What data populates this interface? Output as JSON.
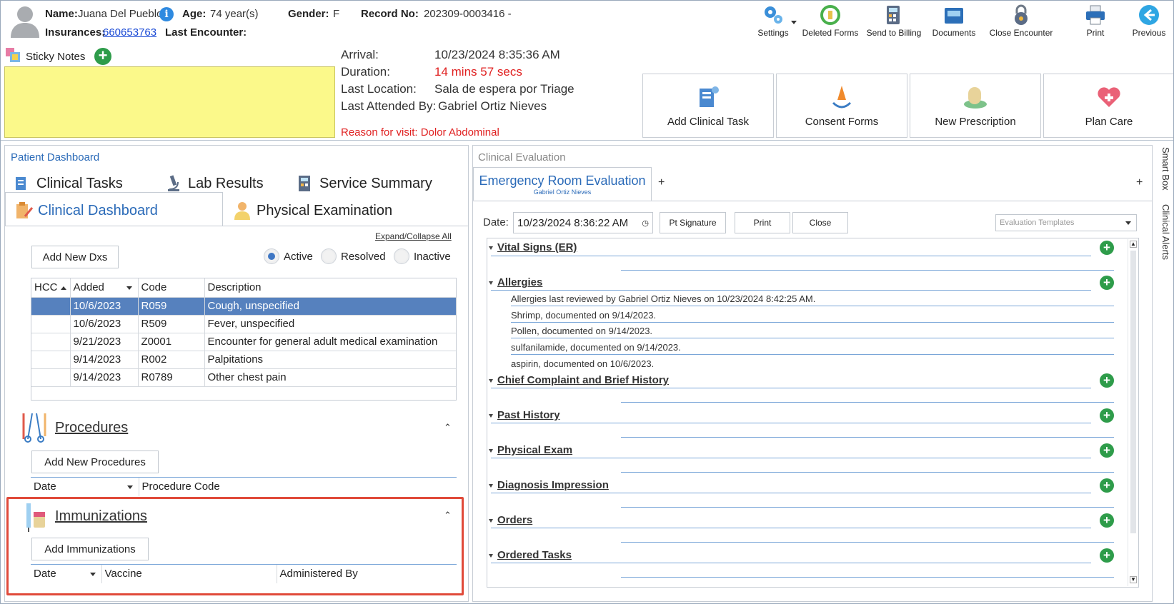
{
  "header": {
    "name_label": "Name:",
    "name_value": "Juana Del Pueblo",
    "info_icon": "info-icon",
    "age_label": "Age:",
    "age_value": "74 year(s)",
    "gender_label": "Gender:",
    "gender_value": "F",
    "record_label": "Record No:",
    "record_value": "202309-0003416 -",
    "insurances_label": "Insurances:",
    "insurances_value": "660653763",
    "last_encounter_label": "Last Encounter:"
  },
  "toolbar": {
    "settings": "Settings",
    "deleted_forms": "Deleted Forms",
    "send_to_billing": "Send to Billing",
    "documents": "Documents",
    "close_encounter": "Close Encounter",
    "print": "Print",
    "previous": "Previous"
  },
  "sticky": {
    "label": "Sticky Notes"
  },
  "visit": {
    "arrival_label": "Arrival:",
    "arrival_value": "10/23/2024 8:35:36 AM",
    "duration_label": "Duration:",
    "duration_value": "14 mins 57 secs",
    "location_label": "Last Location:",
    "location_value": "Sala de espera por Triage",
    "attended_label": "Last Attended By:",
    "attended_value": "Gabriel Ortiz Nieves",
    "reason": "Reason for visit: Dolor Abdominal"
  },
  "actions": {
    "add_clinical_task": "Add Clinical Task",
    "consent_forms": "Consent Forms",
    "new_prescription": "New Prescription",
    "plan_care": "Plan Care"
  },
  "left": {
    "title": "Patient Dashboard",
    "tabs": {
      "clinical_tasks": "Clinical Tasks",
      "lab_results": "Lab Results",
      "service_summary": "Service Summary",
      "clinical_dashboard": "Clinical Dashboard",
      "physical_examination": "Physical Examination"
    },
    "expand_collapse": "Expand/Collapse All",
    "add_new_dxs": "Add New Dxs",
    "filters": {
      "active": "Active",
      "resolved": "Resolved",
      "inactive": "Inactive"
    },
    "dx_columns": {
      "hcc": "HCC",
      "added": "Added",
      "code": "Code",
      "description": "Description"
    },
    "dx_rows": [
      {
        "added": "10/6/2023",
        "code": "R059",
        "description": "Cough, unspecified"
      },
      {
        "added": "10/6/2023",
        "code": "R509",
        "description": "Fever, unspecified"
      },
      {
        "added": "9/21/2023",
        "code": "Z0001",
        "description": "Encounter for general adult medical examination"
      },
      {
        "added": "9/14/2023",
        "code": "R002",
        "description": "Palpitations"
      },
      {
        "added": "9/14/2023",
        "code": "R0789",
        "description": "Other chest pain"
      }
    ],
    "procedures": {
      "title": "Procedures",
      "add": "Add New Procedures",
      "col_date": "Date",
      "col_code": "Procedure Code"
    },
    "immunizations": {
      "title": "Immunizations",
      "add": "Add Immunizations",
      "col_date": "Date",
      "col_vaccine": "Vaccine",
      "col_admin": "Administered By"
    }
  },
  "right": {
    "title": "Clinical Evaluation",
    "tab_title": "Emergency Room Evaluation",
    "tab_sub": "Gabriel Ortiz Nieves",
    "add_tab": "+",
    "date_label": "Date:",
    "date_value": "10/23/2024 8:36:22 AM",
    "pt_signature": "Pt Signature",
    "print": "Print",
    "close": "Close",
    "templates_placeholder": "Evaluation Templates",
    "sections": {
      "vital_signs": "Vital Signs (ER)",
      "allergies": "Allergies",
      "chief_complaint": "Chief Complaint and Brief History",
      "past_history": "Past History",
      "physical_exam": "Physical Exam",
      "diagnosis": "Diagnosis Impression",
      "orders": "Orders",
      "ordered_tasks": "Ordered Tasks"
    },
    "allergy_lines": [
      "Allergies last reviewed by Gabriel Ortiz Nieves on 10/23/2024 8:42:25 AM.",
      "Shrimp, documented on 9/14/2023.",
      "Pollen, documented on 9/14/2023.",
      "sulfanilamide, documented on 9/14/2023.",
      "aspirin, documented on 10/6/2023."
    ]
  },
  "side_tabs": {
    "smart_box": "Smart Box",
    "clinical_alerts": "Clinical Alerts"
  },
  "colors": {
    "accent": "#2a6ab8",
    "selected_row": "#5681be",
    "sticky": "#fbf98a",
    "highlight_box": "#e04a3a",
    "add_green": "#2e9c4a",
    "alert_red": "#e02020"
  }
}
